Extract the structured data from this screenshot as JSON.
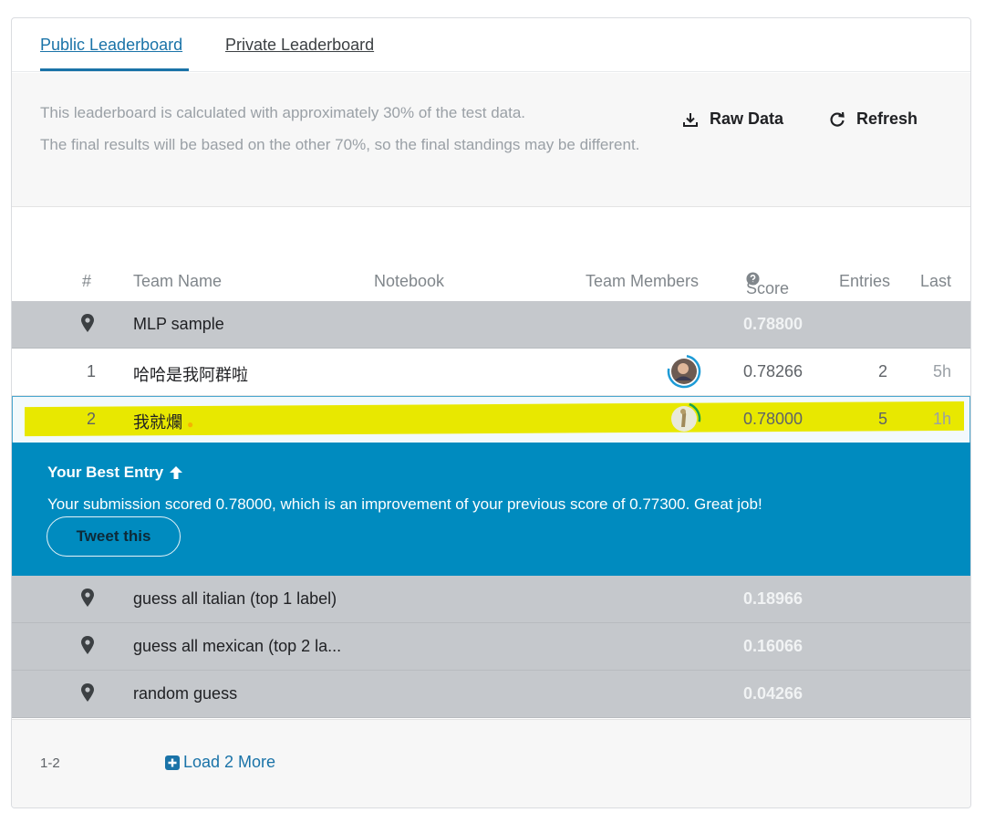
{
  "tabs": [
    {
      "label": "Public Leaderboard",
      "active": true
    },
    {
      "label": "Private Leaderboard",
      "active": false
    }
  ],
  "info": {
    "line1": "This leaderboard is calculated with approximately 30% of the test data.",
    "line2": "The final results will be based on the other 70%, so the final standings may be different."
  },
  "toolbar": {
    "raw_data_label": "Raw Data",
    "refresh_label": "Refresh"
  },
  "table": {
    "headers": {
      "rank": "#",
      "team_name": "Team Name",
      "notebook": "Notebook",
      "team_members": "Team Members",
      "score": "Score",
      "entries": "Entries",
      "last": "Last"
    },
    "benchmark_top": {
      "name": "MLP sample",
      "score": "0.78800"
    },
    "rows": [
      {
        "rank": "1",
        "name": "哈哈是我阿群啦",
        "score": "0.78266",
        "entries": "2",
        "last": "5h"
      },
      {
        "rank": "2",
        "name": "我就爛",
        "score": "0.78000",
        "entries": "5",
        "last": "1h"
      }
    ],
    "benchmarks_bottom": [
      {
        "name": "guess all italian (top 1 label)",
        "score": "0.18966"
      },
      {
        "name": "guess all mexican (top 2 la...",
        "score": "0.16066"
      },
      {
        "name": "random guess",
        "score": "0.04266"
      }
    ]
  },
  "best_entry": {
    "title": "Your Best Entry",
    "message": "Your submission scored 0.78000, which is an improvement of your previous score of 0.77300. Great job!",
    "tweet_label": "Tweet this"
  },
  "footer": {
    "range": "1-2",
    "load_more_label": "Load 2 More"
  },
  "colors": {
    "accent": "#1a73a8",
    "banner": "#008bbf",
    "benchmark_row": "#c5c8cc",
    "highlight": "#e8e800"
  },
  "icons": {
    "raw_data": "download-icon",
    "refresh": "refresh-icon",
    "score_help": "question-circle-icon",
    "benchmark": "map-pin-icon",
    "best_entry": "arrow-up-icon",
    "load_more": "plus-square-icon"
  }
}
